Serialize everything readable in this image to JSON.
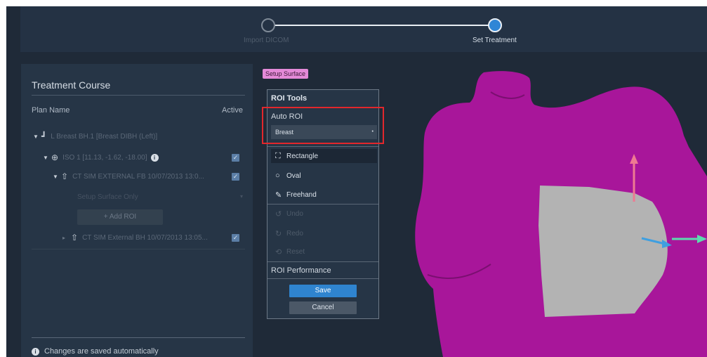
{
  "stepper": {
    "steps": [
      {
        "label": "Import DICOM",
        "state": "completed"
      },
      {
        "label": "Set Treatment",
        "state": "current"
      }
    ]
  },
  "treatment_course": {
    "title": "Treatment Course",
    "columns": {
      "plan_name": "Plan Name",
      "active": "Active"
    },
    "plan": {
      "label": "L Breast BH.1 [Breast DIBH (Left)]"
    },
    "isocenter": {
      "label": "ISO 1 [11.13, -1.62, -18.00]"
    },
    "surfaces": [
      {
        "label": "CT SIM EXTERNAL FB 10/07/2013 13:0...",
        "checked": true,
        "expanded": true
      },
      {
        "label": "CT SIM External BH 10/07/2013 13:05...",
        "checked": true,
        "expanded": false
      }
    ],
    "setup_select": {
      "value": "Setup Surface Only"
    },
    "add_roi_label": "+ Add ROI",
    "footer": "Changes are saved automatically"
  },
  "viewport": {
    "badge": "Setup Surface",
    "colors": {
      "body": "#a8169a",
      "roi": "#b3b3b3",
      "arrow_up": "#ee7a92",
      "arrow_side": "#3f9fe0",
      "arrow_right": "#5cdcae"
    }
  },
  "roi_tools": {
    "title": "ROI Tools",
    "auto_roi_label": "Auto ROI",
    "auto_roi_value": "Breast",
    "tools": [
      {
        "label": "Rectangle",
        "icon": "rectangle-select-icon",
        "selected": true,
        "enabled": true
      },
      {
        "label": "Oval",
        "icon": "circle-icon",
        "selected": false,
        "enabled": true
      },
      {
        "label": "Freehand",
        "icon": "pen-icon",
        "selected": false,
        "enabled": true
      },
      {
        "label": "Undo",
        "icon": "undo-icon",
        "selected": false,
        "enabled": false
      },
      {
        "label": "Redo",
        "icon": "redo-icon",
        "selected": false,
        "enabled": false
      },
      {
        "label": "Reset",
        "icon": "reset-icon",
        "selected": false,
        "enabled": false
      }
    ],
    "performance_label": "ROI Performance",
    "save_label": "Save",
    "cancel_label": "Cancel"
  }
}
